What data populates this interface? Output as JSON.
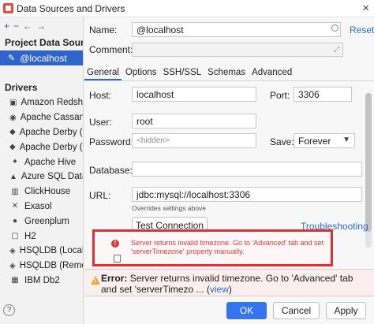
{
  "window": {
    "title": "Data Sources and Drivers"
  },
  "toolbar": {
    "add": "+",
    "remove": "−",
    "back": "←",
    "forward": "→"
  },
  "left": {
    "project_header": "Project Data Sources",
    "data_sources": [
      {
        "label": "@localhost"
      }
    ],
    "drivers_header": "Drivers",
    "drivers": [
      {
        "label": "Amazon Redshift",
        "icon": "redshift-icon"
      },
      {
        "label": "Apache Cassandra",
        "icon": "cassandra-icon"
      },
      {
        "label": "Apache Derby (E",
        "icon": "derby-icon"
      },
      {
        "label": "Apache Derby (R",
        "icon": "derby-icon"
      },
      {
        "label": "Apache Hive",
        "icon": "hive-icon"
      },
      {
        "label": "Azure SQL Datab",
        "icon": "azure-icon"
      },
      {
        "label": "ClickHouse",
        "icon": "clickhouse-icon"
      },
      {
        "label": "Exasol",
        "icon": "exasol-icon"
      },
      {
        "label": "Greenplum",
        "icon": "greenplum-icon"
      },
      {
        "label": "H2",
        "icon": "h2-icon"
      },
      {
        "label": "HSQLDB (Local)",
        "icon": "hsqldb-icon"
      },
      {
        "label": "HSQLDB (Remot",
        "icon": "hsqldb-icon"
      },
      {
        "label": "IBM Db2",
        "icon": "db2-icon"
      }
    ]
  },
  "form": {
    "name_label": "Name:",
    "name_value": "@localhost",
    "reset": "Reset",
    "comment_label": "Comment:",
    "tabs": [
      "General",
      "Options",
      "SSH/SSL",
      "Schemas",
      "Advanced"
    ],
    "host_label": "Host:",
    "host_value": "localhost",
    "port_label": "Port:",
    "port_value": "3306",
    "user_label": "User:",
    "user_value": "root",
    "password_label": "Password:",
    "password_value": "<hidden>",
    "save_label": "Save:",
    "save_value": "Forever",
    "database_label": "Database:",
    "url_label": "URL:",
    "url_value": "jdbc:mysql://localhost:3306",
    "overrides_note": "Overrides settings above",
    "test_connection": "Test Connection",
    "troubleshooting": "Troubleshooting"
  },
  "popup": {
    "message": "Server returns invalid timezone. Go to 'Advanced' tab and set 'serverTimezone' property manually."
  },
  "error_bar": {
    "prefix": "Error:",
    "text": "Server returns invalid timezone. Go to 'Advanced' tab and set 'serverTimezo ... (",
    "view": "view",
    "suffix": ")"
  },
  "buttons": {
    "ok": "OK",
    "cancel": "Cancel",
    "apply": "Apply"
  },
  "colors": {
    "accent": "#2f65ca",
    "error": "#d83b3b",
    "highlight_box": "#e03030"
  }
}
